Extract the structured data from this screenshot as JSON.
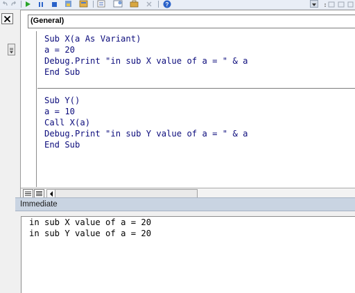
{
  "toolbar": {
    "icons": [
      "run-icon",
      "break-icon",
      "reset-icon",
      "design-mode-icon",
      "project-explorer-icon",
      "properties-icon",
      "object-browser-icon",
      "toolbox-icon",
      "help-icon"
    ]
  },
  "object_combo": {
    "value": "(General)"
  },
  "code": {
    "proc_x": [
      "Sub X(a As Variant)",
      "a = 20",
      "Debug.Print \"in sub X value of a = \" & a",
      "End Sub"
    ],
    "proc_y": [
      "Sub Y()",
      "a = 10",
      "Call X(a)",
      "Debug.Print \"in sub Y value of a = \" & a",
      "End Sub"
    ]
  },
  "immediate": {
    "title": "Immediate",
    "lines": [
      "in sub X value of a = 20",
      "in sub Y value of a = 20"
    ]
  },
  "colors": {
    "code_text": "#0c0c7c",
    "immediate_title_bg": "#c9d4e2",
    "toolbar_bg": "#e9eef6"
  }
}
